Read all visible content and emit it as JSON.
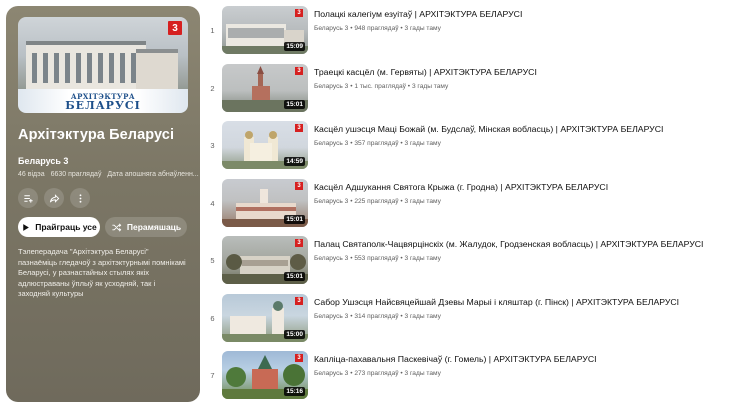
{
  "playlist": {
    "hero_logo_line1": "АРХІТЭКТУРА",
    "hero_logo_line2": "БЕЛАРУСІ",
    "hero_badge": "3",
    "title": "Архітэктура Беларусі",
    "owner": "Беларусь 3",
    "video_count": "46 відэа",
    "views": "6630 праглядаў",
    "updated": "Дата апошняга абнаўленн...",
    "play_all_label": "Прайграць усе",
    "shuffle_label": "Перамяшаць",
    "description": "Тэлеперадача \"Архітэктура Беларусі\" пазнаёміць гледачоў з архітэктурнымі помнікамі Беларусі, у разнастайных стылях якіх адлюстраваны ўплыў як усходняй, так і заходняй культуры"
  },
  "videos": [
    {
      "index": "1",
      "title": "Полацкі калегіум езуітаў | АРХІТЭКТУРА БЕЛАРУСІ",
      "channel": "Беларусь 3",
      "views": "948 праглядаў",
      "age": "3 гады таму",
      "duration": "15:09",
      "badge": "3"
    },
    {
      "index": "2",
      "title": "Траецкі касцёл (м. Гервяты) | АРХІТЭКТУРА БЕЛАРУСІ",
      "channel": "Беларусь 3",
      "views": "1 тыс. праглядаў",
      "age": "3 гады таму",
      "duration": "15:01",
      "badge": "3"
    },
    {
      "index": "3",
      "title": "Касцёл ушэсця Маці Божай (м. Будслаў, Мінская вобласць) | АРХІТЭКТУРА БЕЛАРУСІ",
      "channel": "Беларусь 3",
      "views": "357 праглядаў",
      "age": "3 гады таму",
      "duration": "14:59",
      "badge": "3"
    },
    {
      "index": "4",
      "title": "Касцёл Адшукання Святога Крыжа (г. Гродна) | АРХІТЭКТУРА БЕЛАРУСІ",
      "channel": "Беларусь 3",
      "views": "225 праглядаў",
      "age": "3 гады таму",
      "duration": "15:01",
      "badge": "3"
    },
    {
      "index": "5",
      "title": "Палац Святаполк-Чацвярцінскіх (м. Жалудок, Гродзенская вобласць) | АРХІТЭКТУРА БЕЛАРУСІ",
      "channel": "Беларусь 3",
      "views": "553 праглядаў",
      "age": "3 гады таму",
      "duration": "15:01",
      "badge": "3"
    },
    {
      "index": "6",
      "title": "Сабор Ушэсця Найсвяцейшай Дзевы Марыі і кляштар (г. Пінск) | АРХІТЭКТУРА БЕЛАРУСІ",
      "channel": "Беларусь 3",
      "views": "314 праглядаў",
      "age": "3 гады таму",
      "duration": "15:00",
      "badge": "3"
    },
    {
      "index": "7",
      "title": "Капліца-пахавальня Паскевічаў (г. Гомель) | АРХІТЭКТУРА БЕЛАРУСІ",
      "channel": "Беларусь 3",
      "views": "273 праглядаў",
      "age": "3 гады таму",
      "duration": "15:16",
      "badge": "3"
    }
  ],
  "meta_separator": "•",
  "icons": {
    "save": "add-to-queue-icon",
    "share": "share-icon",
    "more": "more-vert-icon",
    "play": "play-icon",
    "shuffle": "shuffle-icon"
  }
}
